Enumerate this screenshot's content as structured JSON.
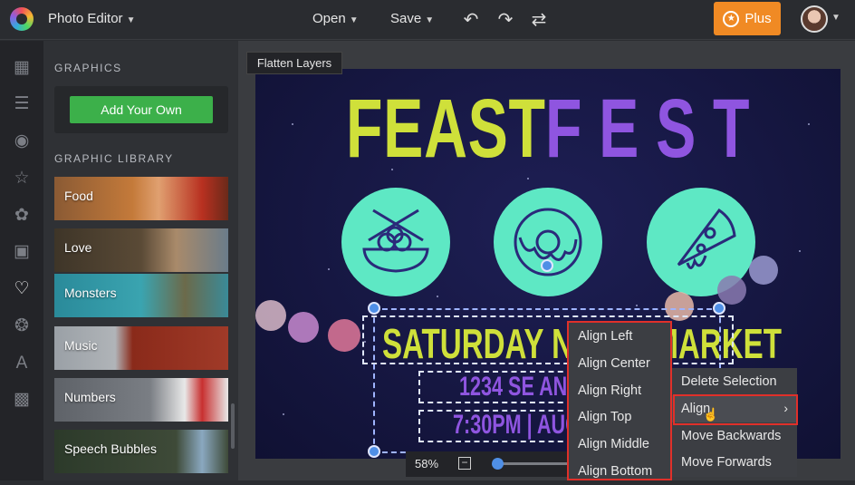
{
  "topbar": {
    "app_title": "Photo Editor",
    "open_label": "Open",
    "save_label": "Save",
    "plus_label": "Plus"
  },
  "rail": {
    "icons": [
      "image-icon",
      "sliders-icon",
      "eye-icon",
      "star-icon",
      "flower-icon",
      "frame-icon",
      "heart-icon",
      "badge-icon",
      "text-icon",
      "texture-icon"
    ],
    "active": "heart-icon"
  },
  "panel": {
    "graphics_title": "GRAPHICS",
    "add_own_label": "Add Your Own",
    "library_title": "GRAPHIC LIBRARY",
    "library_items": [
      "Food",
      "Love",
      "Monsters",
      "Music",
      "Numbers",
      "Speech Bubbles"
    ]
  },
  "canvas": {
    "flatten_label": "Flatten Layers",
    "poster": {
      "title_part1": "FEAST",
      "title_part2": "FEST",
      "line1": "SATURDAY NIGHT MARKET",
      "line2": "1234 SE ANKENY",
      "line3": "7:30PM | AUG"
    }
  },
  "zoom": {
    "label": "58%",
    "value": 0.58
  },
  "context_menu": {
    "items": [
      "Delete Selection",
      "Align",
      "Move Backwards",
      "Move Forwards"
    ]
  },
  "align_submenu": {
    "items": [
      "Align Left",
      "Align Center",
      "Align Right",
      "Align Top",
      "Align Middle",
      "Align Bottom"
    ]
  },
  "colors": {
    "accent_orange": "#f08a24",
    "add_green": "#3cb04a",
    "poster_yellow": "#cfe03a",
    "poster_purple": "#8f55e0",
    "poster_mint": "#5ee8c4",
    "highlight_red": "#e0302a"
  }
}
